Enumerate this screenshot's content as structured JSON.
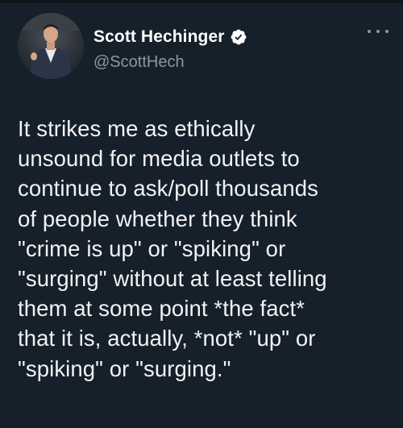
{
  "author": {
    "display_name": "Scott Hechinger",
    "handle": "@ScottHech",
    "verified": true,
    "avatar_icon": "profile-photo"
  },
  "tweet": {
    "text": "It strikes me as ethically\nunsound for media outlets to\ncontinue to ask/poll thousands\nof people whether they think\n\"crime is up\" or \"spiking\" or\n\"surging\" without at least telling\nthem at some point *the fact*\nthat it is, actually, *not* \"up\" or\n\"spiking\" or \"surging.\""
  },
  "icons": {
    "verified": "verified-badge-icon",
    "more": "more-options-icon"
  },
  "colors": {
    "background": "#15202b",
    "text": "#ffffff",
    "secondary_text": "#8b98a5"
  }
}
